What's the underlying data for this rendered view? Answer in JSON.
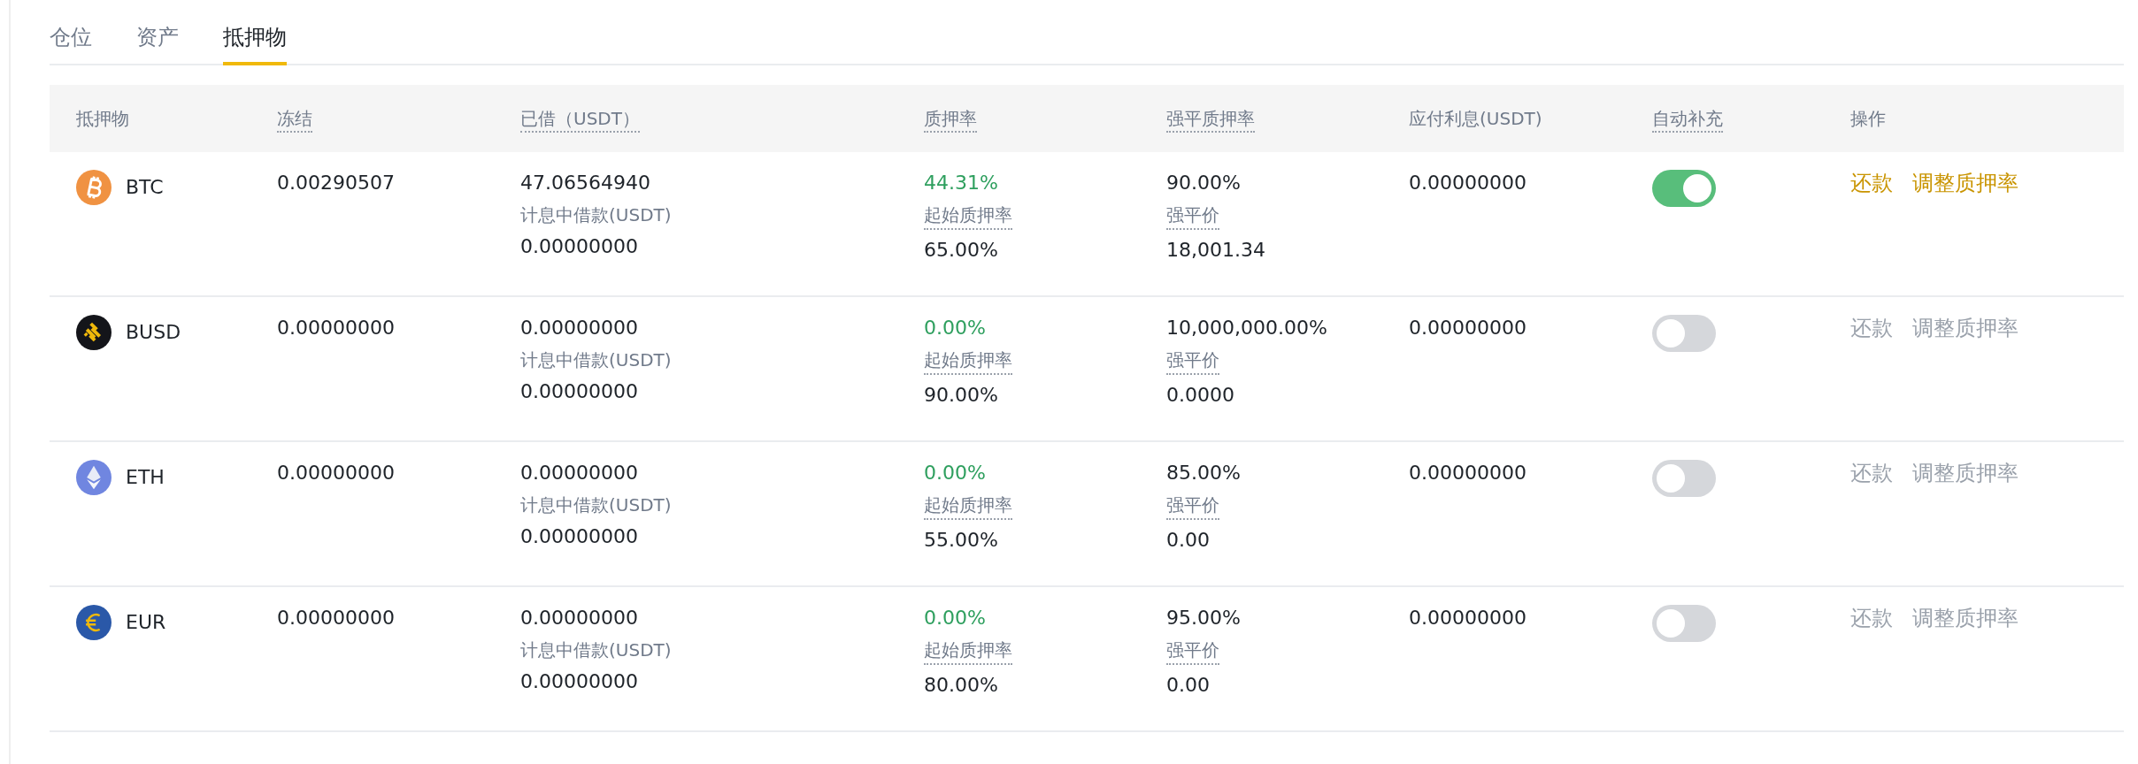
{
  "tabs": [
    {
      "label": "仓位",
      "selected": false
    },
    {
      "label": "资产",
      "selected": false
    },
    {
      "label": "抵押物",
      "selected": true
    }
  ],
  "table": {
    "columns": [
      {
        "label": "抵押物",
        "dotted": false
      },
      {
        "label": "冻结",
        "dotted": true
      },
      {
        "label": "已借（USDT）",
        "dotted": true
      },
      {
        "label": "质押率",
        "dotted": true
      },
      {
        "label": "强平质押率",
        "dotted": true
      },
      {
        "label": "应付利息(USDT)",
        "dotted": false
      },
      {
        "label": "自动补充",
        "dotted": true
      },
      {
        "label": "操作",
        "dotted": false
      }
    ],
    "rows": [
      {
        "kind": "btc",
        "symbol": "BTC",
        "frozen": "0.00290507",
        "borrowed": "47.06564940",
        "borrowed_sub_label": "计息中借款(USDT)",
        "borrowed_sub_value": "0.00000000",
        "ratio": "44.31%",
        "initial_label": "起始质押率",
        "initial_value": "65.00%",
        "liq_ratio": "90.00%",
        "liq_price_label": "强平价",
        "liq_price": "18,001.34",
        "interest": "0.00000000",
        "auto_topup_on": true,
        "actions": [
          {
            "label": "还款",
            "disabled": false
          },
          {
            "label": "调整质押率",
            "disabled": false
          }
        ]
      },
      {
        "kind": "busd",
        "symbol": "BUSD",
        "frozen": "0.00000000",
        "borrowed": "0.00000000",
        "borrowed_sub_label": "计息中借款(USDT)",
        "borrowed_sub_value": "0.00000000",
        "ratio": "0.00%",
        "initial_label": "起始质押率",
        "initial_value": "90.00%",
        "liq_ratio": "10,000,000.00%",
        "liq_price_label": "强平价",
        "liq_price": "0.0000",
        "interest": "0.00000000",
        "auto_topup_on": false,
        "actions": [
          {
            "label": "还款",
            "disabled": true
          },
          {
            "label": "调整质押率",
            "disabled": true
          }
        ]
      },
      {
        "kind": "eth",
        "symbol": "ETH",
        "frozen": "0.00000000",
        "borrowed": "0.00000000",
        "borrowed_sub_label": "计息中借款(USDT)",
        "borrowed_sub_value": "0.00000000",
        "ratio": "0.00%",
        "initial_label": "起始质押率",
        "initial_value": "55.00%",
        "liq_ratio": "85.00%",
        "liq_price_label": "强平价",
        "liq_price": "0.00",
        "interest": "0.00000000",
        "auto_topup_on": false,
        "actions": [
          {
            "label": "还款",
            "disabled": true
          },
          {
            "label": "调整质押率",
            "disabled": true
          }
        ]
      },
      {
        "kind": "eur",
        "symbol": "EUR",
        "frozen": "0.00000000",
        "borrowed": "0.00000000",
        "borrowed_sub_label": "计息中借款(USDT)",
        "borrowed_sub_value": "0.00000000",
        "ratio": "0.00%",
        "initial_label": "起始质押率",
        "initial_value": "80.00%",
        "liq_ratio": "95.00%",
        "liq_price_label": "强平价",
        "liq_price": "0.00",
        "interest": "0.00000000",
        "auto_topup_on": false,
        "actions": [
          {
            "label": "还款",
            "disabled": true
          },
          {
            "label": "调整质押率",
            "disabled": true
          }
        ]
      }
    ]
  }
}
